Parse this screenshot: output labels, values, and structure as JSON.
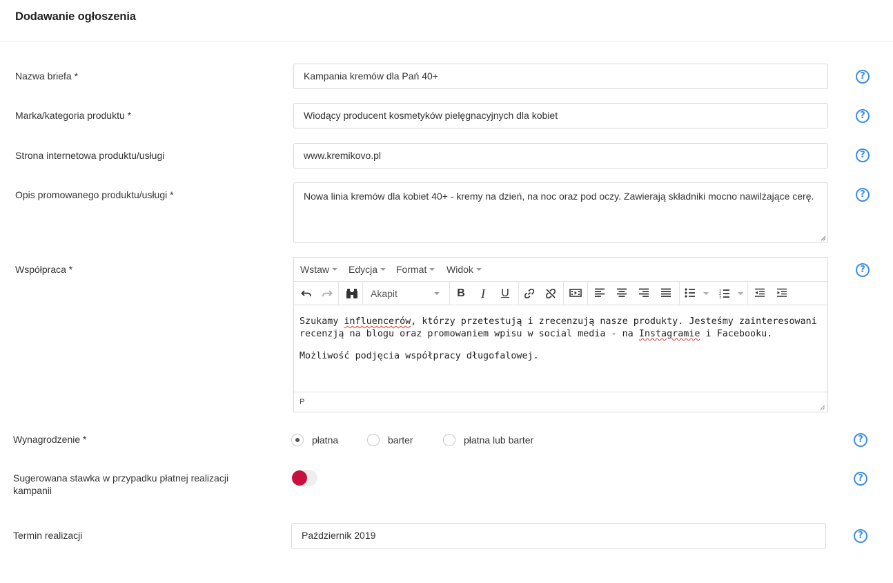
{
  "header": {
    "title": "Dodawanie ogłoszenia"
  },
  "form": {
    "name": {
      "label": "Nazwa briefa *",
      "value": "Kampania kremów dla Pań 40+"
    },
    "brand": {
      "label": "Marka/kategoria produktu *",
      "value": "Wiodący producent kosmetyków pielęgnacyjnych dla kobiet"
    },
    "website": {
      "label": "Strona internetowa produktu/usługi",
      "value": "www.kremikovo.pl"
    },
    "description": {
      "label": "Opis promowanego produktu/usługi *",
      "value": "Nowa linia kremów dla kobiet 40+ - kremy na dzień, na noc oraz pod oczy. Zawierają składniki mocno nawilżające cerę."
    },
    "cooperation": {
      "label": "Współpraca *",
      "menu": [
        "Wstaw",
        "Edycja",
        "Format",
        "Widok"
      ],
      "block_format": "Akapit",
      "body": {
        "p1_part1": "Szukamy ",
        "p1_word1": "influencerów",
        "p1_part2": ", którzy przetestują i zrecenzują nasze produkty. Jesteśmy zainteresowani recenzją na blogu oraz promowaniem wpisu w social media - na ",
        "p1_word2": "Instagramie",
        "p1_part3": " i Facebooku.",
        "p2": "Możliwość podjęcia współpracy długofalowej."
      },
      "status_path": "P"
    },
    "compensation": {
      "label": "Wynagrodzenie *",
      "options": [
        "płatna",
        "barter",
        "płatna lub barter"
      ],
      "selected": "płatna"
    },
    "suggested_rate": {
      "label": "Sugerowana stawka w przypadku płatnej realizacji kampanii",
      "enabled": false
    },
    "deadline": {
      "label": "Termin realizacji",
      "value": "Październik 2019"
    }
  },
  "help_glyph": "?",
  "colors": {
    "accent": "#3a8ee6",
    "toggle_knob": "#c8103e"
  }
}
